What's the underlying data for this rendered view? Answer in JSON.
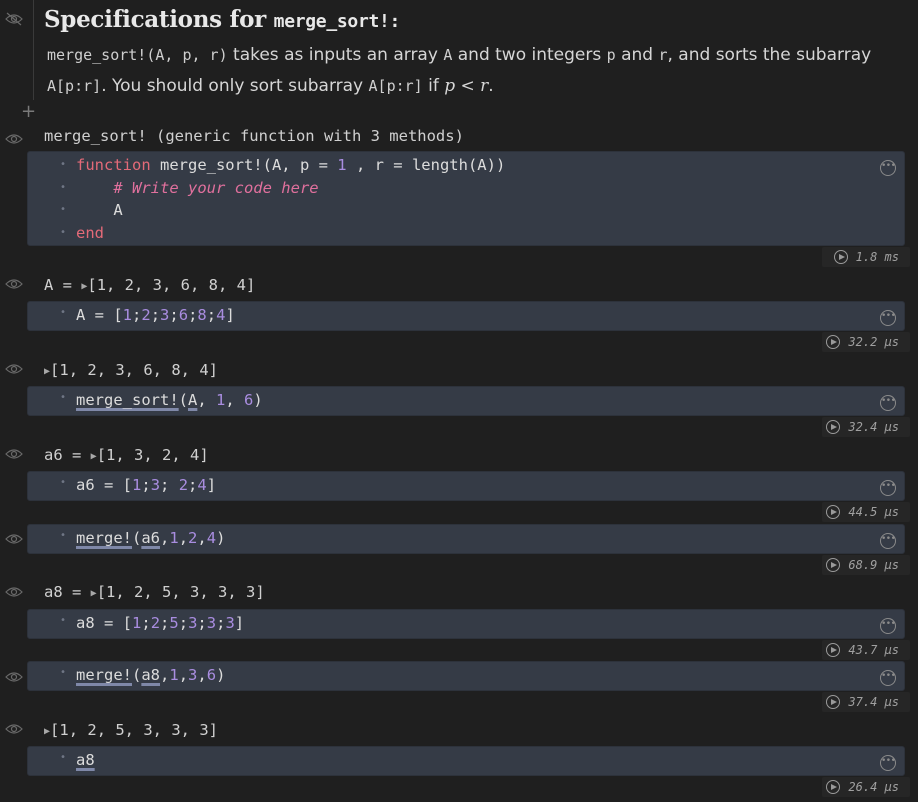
{
  "markdown": {
    "title_prefix": "Specifications for ",
    "title_code": "merge_sort!:",
    "p1_code": "merge_sort!(A, p, r)",
    "p1_text1": " takes as inputs an array ",
    "p1_codeA": "A",
    "p1_text2": " and two integers ",
    "p1_codep": "p",
    "p1_text3": " and ",
    "p1_coder": "r",
    "p1_text4": ", and sorts the subarray ",
    "p2_code": "A[p:r]",
    "p2_text1": ". You should only sort subarray ",
    "p2_code2": "A[p:r]",
    "p2_text2": " if ",
    "p2_math": "p < r",
    "p2_end": "."
  },
  "cells": [
    {
      "output": "merge_sort! (generic function with 3 methods)",
      "lines": [
        "function merge_sort!(A, p = 1 , r = length(A))",
        "    # Write your code here",
        "    A",
        "end"
      ],
      "runtime": "1.8 ms"
    },
    {
      "output_name": "A = ",
      "output_value": "[1, 2, 3, 6, 8, 4]",
      "code": "A = [1;2;3;6;8;4]",
      "runtime": "32.2 μs"
    },
    {
      "output_name": "",
      "output_value": "[1, 2, 3, 6, 8, 4]",
      "code": "merge_sort!(A, 1, 6)",
      "runtime": "32.4 μs"
    },
    {
      "output_name": "a6 = ",
      "output_value": "[1, 3, 2, 4]",
      "code": "a6 = [1;3; 2;4]",
      "runtime": "44.5 μs"
    },
    {
      "code": "merge!(a6,1,2,4)",
      "runtime": "68.9 μs"
    },
    {
      "output_name": "a8 = ",
      "output_value": "[1, 2, 5, 3, 3, 3]",
      "code": "a8 = [1;2;5;3;3;3]",
      "runtime": "43.7 μs"
    },
    {
      "code": "merge!(a8,1,3,6)",
      "runtime": "37.4 μs"
    },
    {
      "output_name": "",
      "output_value": "[1, 2, 5, 3, 3, 3]",
      "code": "a8",
      "runtime": "26.4 μs"
    }
  ],
  "icons": {
    "hidden_eye": "eye-slash-icon",
    "eye": "eye-icon",
    "more": "more-options-icon",
    "run": "run-cell-icon",
    "add": "add-cell-icon",
    "disclosure": "disclosure-triangle-icon"
  }
}
